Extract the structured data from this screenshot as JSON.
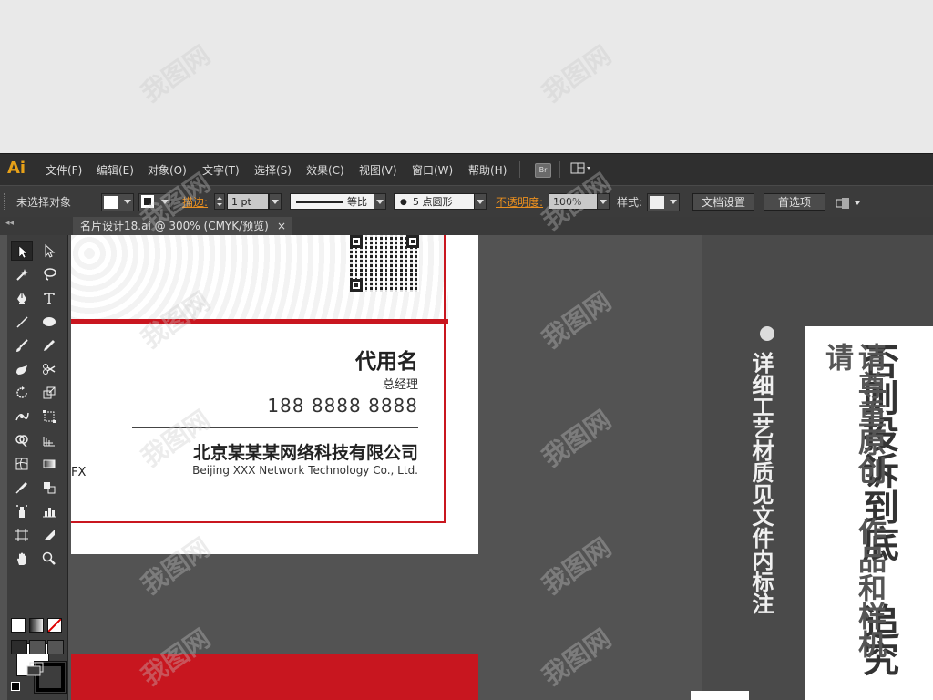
{
  "app": {
    "logo": "Ai",
    "menu": [
      "文件(F)",
      "编辑(E)",
      "对象(O)",
      "文字(T)",
      "选择(S)",
      "效果(C)",
      "视图(V)",
      "窗口(W)",
      "帮助(H)"
    ],
    "bridge_label": "Br"
  },
  "control_bar": {
    "selection_status": "未选择对象",
    "stroke_label": "描边:",
    "stroke_value": "1 pt",
    "profile_label": "等比",
    "brush_label": "5 点圆形",
    "opacity_label": "不透明度:",
    "opacity_value": "100%",
    "style_label": "样式:",
    "doc_setup_button": "文档设置",
    "preferences_button": "首选项"
  },
  "document_tab": {
    "title": "名片设计18.ai @ 300% (CMYK/预览)",
    "close": "×"
  },
  "card": {
    "name": "代用名",
    "job_title": "总经理",
    "phone": "188 8888 8888",
    "company_cn": "北京某某某网络科技有限公司",
    "company_en": "Beijing XXX Network Technology Co., Ltd.",
    "partial_text": "FX"
  },
  "side_notice": {
    "details": "详细工艺材质见文件内标注",
    "warning_main": "否则投诉到底 追究",
    "warning_sub": "请尊重原创 作品和样机 请"
  },
  "watermark": "我图网",
  "colors": {
    "accent_red": "#c9161f",
    "ai_orange": "#e7a118",
    "panel_dark": "#3d3d3d",
    "canvas_gray": "#535353"
  }
}
